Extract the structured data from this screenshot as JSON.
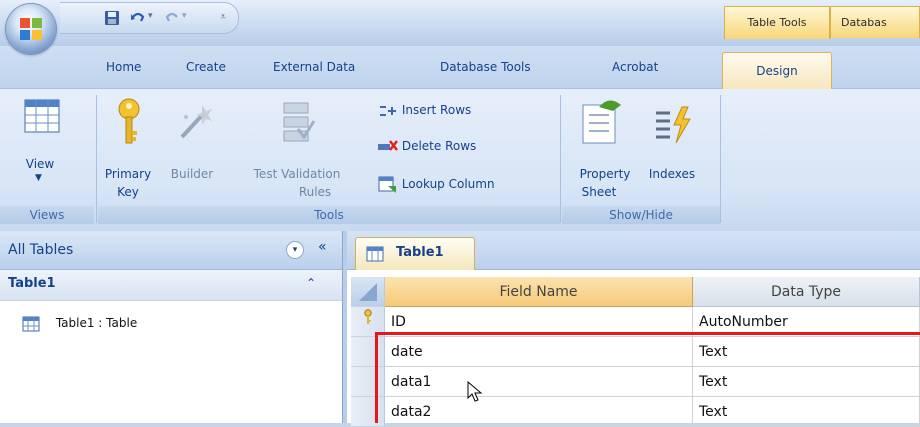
{
  "titlebar": {
    "context_tabs": [
      "Table Tools",
      "Databas"
    ]
  },
  "ribbon_tabs": [
    "Home",
    "Create",
    "External Data",
    "Database Tools",
    "Acrobat",
    "Design"
  ],
  "ribbon": {
    "groups": {
      "views": "Views",
      "tools": "Tools",
      "show_hide": "Show/Hide"
    },
    "view_label": "View",
    "primary_key_line1": "Primary",
    "primary_key_line2": "Key",
    "builder_label": "Builder",
    "test_validation_line1": "Test Validation",
    "test_validation_line2": "Rules",
    "insert_rows": "Insert Rows",
    "delete_rows": "Delete Rows",
    "lookup_column": "Lookup Column",
    "property_sheet_line1": "Property",
    "property_sheet_line2": "Sheet",
    "indexes_label": "Indexes"
  },
  "nav": {
    "header": "All Tables",
    "group": "Table1",
    "items": [
      "Table1 : Table"
    ]
  },
  "doc": {
    "tab_label": "Table1",
    "columns": [
      "Field Name",
      "Data Type"
    ],
    "rows": [
      {
        "field": "ID",
        "type": "AutoNumber",
        "primary_key": true
      },
      {
        "field": "date",
        "type": "Text"
      },
      {
        "field": "data1",
        "type": "Text"
      },
      {
        "field": "data2",
        "type": "Text"
      }
    ]
  },
  "colors": {
    "highlight_box": "#e8151b",
    "header_orange": "#f6c978",
    "ribbon_blue": "#d7e5f6"
  }
}
